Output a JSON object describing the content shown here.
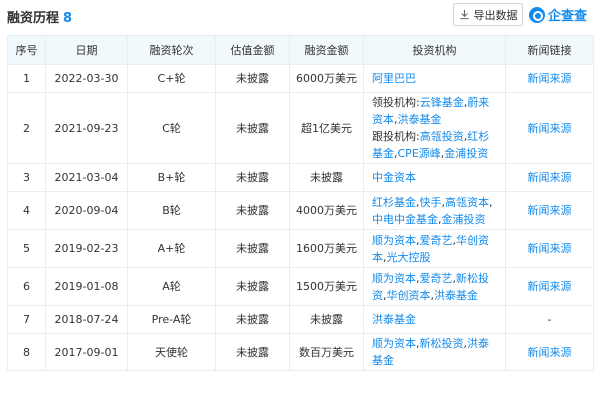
{
  "header": {
    "title": "融资历程",
    "count": "8",
    "export_label": "导出数据",
    "logo_text": "企查查"
  },
  "colors": {
    "accent": "#128bed",
    "header_bg": "#f2f9fc",
    "border": "#e4eef6"
  },
  "table": {
    "columns": [
      "序号",
      "日期",
      "融资轮次",
      "估值金额",
      "融资金额",
      "投资机构",
      "新闻链接"
    ],
    "rows": [
      {
        "index": "1",
        "date": "2022-03-30",
        "round": "C+轮",
        "valuation": "未披露",
        "amount": "6000万美元",
        "investor_groups": [
          {
            "label": "",
            "items": [
              "阿里巴巴"
            ]
          }
        ],
        "news": "新闻来源"
      },
      {
        "index": "2",
        "date": "2021-09-23",
        "round": "C轮",
        "valuation": "未披露",
        "amount": "超1亿美元",
        "investor_groups": [
          {
            "label": "领投机构:",
            "items": [
              "云锋基金",
              "蔚来资本",
              "洪泰基金"
            ]
          },
          {
            "label": "跟投机构:",
            "items": [
              "高瓴投资",
              "红杉基金",
              "CPE源峰",
              "金浦投资"
            ]
          }
        ],
        "news": "新闻来源"
      },
      {
        "index": "3",
        "date": "2021-03-04",
        "round": "B+轮",
        "valuation": "未披露",
        "amount": "未披露",
        "investor_groups": [
          {
            "label": "",
            "items": [
              "中金资本"
            ]
          }
        ],
        "news": "新闻来源"
      },
      {
        "index": "4",
        "date": "2020-09-04",
        "round": "B轮",
        "valuation": "未披露",
        "amount": "4000万美元",
        "investor_groups": [
          {
            "label": "",
            "items": [
              "红杉基金",
              "快手",
              "高瓴资本",
              "中电中金基金",
              "金浦投资"
            ]
          }
        ],
        "news": "新闻来源"
      },
      {
        "index": "5",
        "date": "2019-02-23",
        "round": "A+轮",
        "valuation": "未披露",
        "amount": "1600万美元",
        "investor_groups": [
          {
            "label": "",
            "items": [
              "顺为资本",
              "爱奇艺",
              "华创资本",
              "光大控股"
            ]
          }
        ],
        "news": "新闻来源"
      },
      {
        "index": "6",
        "date": "2019-01-08",
        "round": "A轮",
        "valuation": "未披露",
        "amount": "1500万美元",
        "investor_groups": [
          {
            "label": "",
            "items": [
              "顺为资本",
              "爱奇艺",
              "新松投资",
              "华创资本",
              "洪泰基金"
            ]
          }
        ],
        "news": "新闻来源"
      },
      {
        "index": "7",
        "date": "2018-07-24",
        "round": "Pre-A轮",
        "valuation": "未披露",
        "amount": "未披露",
        "investor_groups": [
          {
            "label": "",
            "items": [
              "洪泰基金"
            ]
          }
        ],
        "news": "-"
      },
      {
        "index": "8",
        "date": "2017-09-01",
        "round": "天使轮",
        "valuation": "未披露",
        "amount": "数百万美元",
        "investor_groups": [
          {
            "label": "",
            "items": [
              "顺为资本",
              "新松投资",
              "洪泰基金"
            ]
          }
        ],
        "news": "新闻来源"
      }
    ]
  }
}
